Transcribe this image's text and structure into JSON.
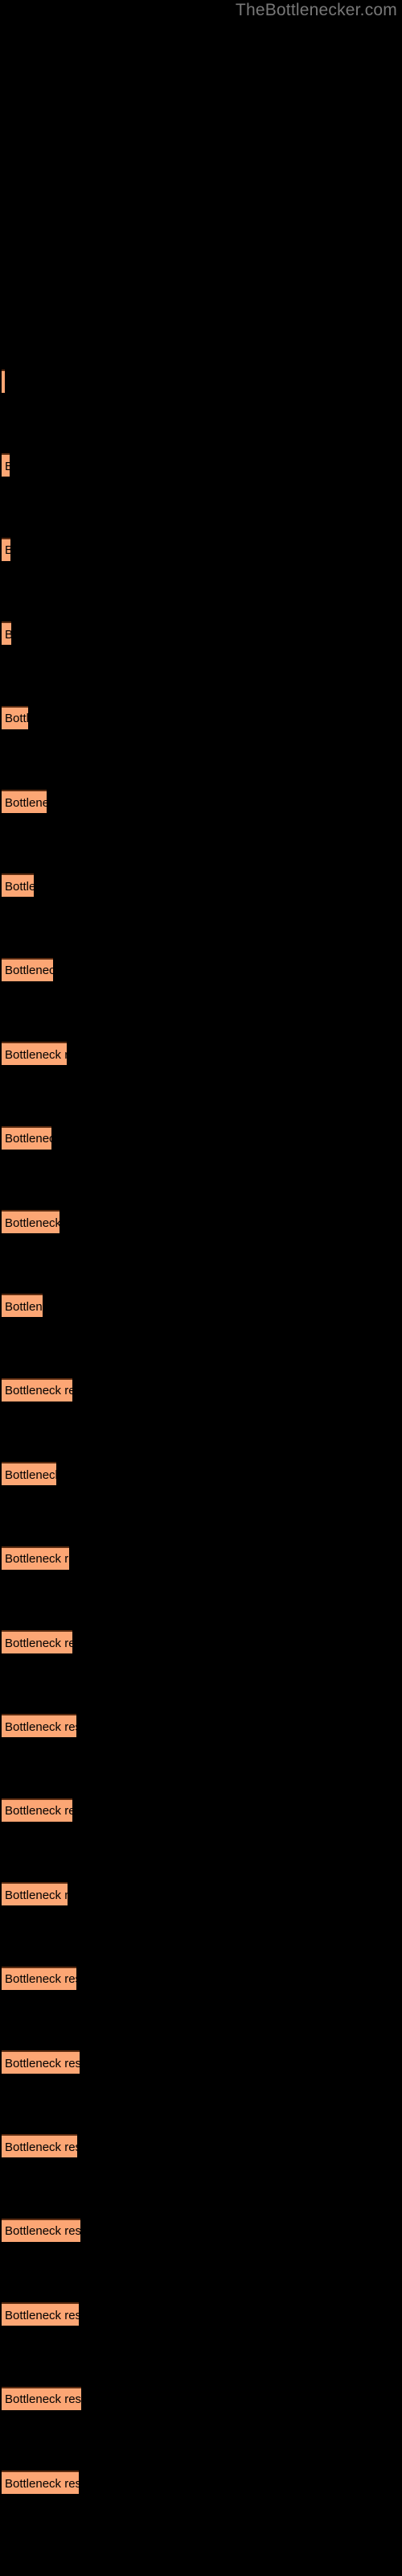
{
  "header": {
    "watermark": "TheBottlenecker.com"
  },
  "colors": {
    "background": "#000000",
    "bar_fill": "#fca674",
    "bar_edge": "#5a2b10",
    "bar_label_text": "#000000",
    "watermark_text": "#787878"
  },
  "chart_data": {
    "type": "bar",
    "orientation": "horizontal",
    "title": "",
    "subtitle": "",
    "xlabel": "",
    "ylabel": "",
    "grid": false,
    "legend": null,
    "axis_visible": false,
    "tick_labels_visible": false,
    "xlim": [
      0,
      500
    ],
    "bar_label_text": "Bottleneck result",
    "categories": [
      "bar-1",
      "bar-2",
      "bar-3",
      "bar-4",
      "bar-5",
      "bar-6",
      "bar-7",
      "bar-8",
      "bar-9",
      "bar-10",
      "bar-11",
      "bar-12",
      "bar-13",
      "bar-14",
      "bar-15",
      "bar-16",
      "bar-17",
      "bar-18",
      "bar-19",
      "bar-20",
      "bar-21",
      "bar-22",
      "bar-23",
      "bar-24",
      "bar-25",
      "bar-26"
    ],
    "values": [
      4,
      10,
      11,
      12,
      33,
      56,
      40,
      64,
      81,
      62,
      72,
      51,
      88,
      68,
      84,
      88,
      93,
      88,
      82,
      93,
      97,
      94,
      98,
      96,
      99,
      96
    ],
    "bars": [
      {
        "label": "Bottleneck result",
        "width": 4,
        "top": 459
      },
      {
        "label": "Bottleneck result",
        "width": 10,
        "top": 502
      },
      {
        "label": "Bottleneck result",
        "width": 11,
        "top": 545
      },
      {
        "label": "Bottleneck result",
        "width": 12,
        "top": 588
      },
      {
        "label": "Bottleneck result",
        "width": 33,
        "top": 631
      },
      {
        "label": "Bottleneck result",
        "width": 56,
        "top": 674
      },
      {
        "label": "Bottleneck result",
        "width": 40,
        "top": 717
      },
      {
        "label": "Bottleneck result",
        "width": 64,
        "top": 760
      },
      {
        "label": "Bottleneck result",
        "width": 81,
        "top": 803
      },
      {
        "label": "Bottleneck result",
        "width": 62,
        "top": 846
      },
      {
        "label": "Bottleneck result",
        "width": 72,
        "top": 889
      },
      {
        "label": "Bottleneck result",
        "width": 51,
        "top": 932
      },
      {
        "label": "Bottleneck result",
        "width": 88,
        "top": 975
      },
      {
        "label": "Bottleneck result",
        "width": 68,
        "top": 1018
      },
      {
        "label": "Bottleneck result",
        "width": 84,
        "top": 1061
      },
      {
        "label": "Bottleneck result",
        "width": 88,
        "top": 1104
      },
      {
        "label": "Bottleneck result",
        "width": 93,
        "top": 1147
      },
      {
        "label": "Bottleneck result",
        "width": 88,
        "top": 1190
      },
      {
        "label": "Bottleneck result",
        "width": 82,
        "top": 1233
      },
      {
        "label": "Bottleneck result",
        "width": 93,
        "top": 1276
      },
      {
        "label": "Bottleneck result",
        "width": 97,
        "top": 1319
      },
      {
        "label": "Bottleneck result",
        "width": 94,
        "top": 1362
      },
      {
        "label": "Bottleneck result",
        "width": 98,
        "top": 1405
      },
      {
        "label": "Bottleneck result",
        "width": 96,
        "top": 1448
      },
      {
        "label": "Bottleneck result",
        "width": 99,
        "top": 1491
      },
      {
        "label": "Bottleneck result",
        "width": 96,
        "top": 1534
      }
    ]
  }
}
